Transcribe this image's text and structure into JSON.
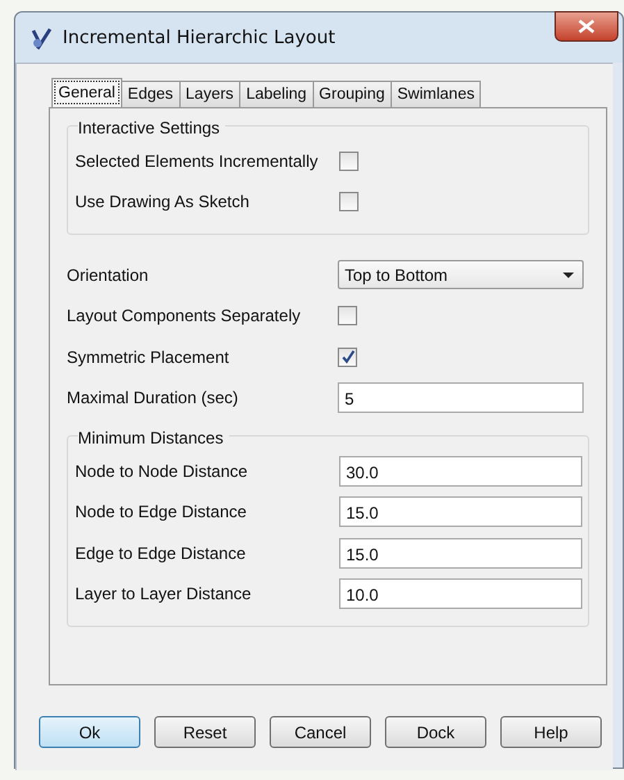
{
  "window": {
    "title": "Incremental Hierarchic Layout"
  },
  "tabs": [
    {
      "label": "General",
      "selected": true
    },
    {
      "label": "Edges",
      "selected": false
    },
    {
      "label": "Layers",
      "selected": false
    },
    {
      "label": "Labeling",
      "selected": false
    },
    {
      "label": "Grouping",
      "selected": false
    },
    {
      "label": "Swimlanes",
      "selected": false
    }
  ],
  "sections": [
    {
      "kind": "group",
      "title": "Interactive Settings",
      "rows": [
        {
          "kind": "checkbox",
          "label": "Selected Elements Incrementally",
          "checked": false
        },
        {
          "kind": "checkbox",
          "label": "Use Drawing As Sketch",
          "checked": false
        }
      ]
    },
    {
      "kind": "plain",
      "rows": [
        {
          "kind": "dropdown",
          "label": "Orientation",
          "value": "Top to Bottom"
        },
        {
          "kind": "checkbox",
          "label": "Layout Components Separately",
          "checked": false
        },
        {
          "kind": "checkbox",
          "label": "Symmetric Placement",
          "checked": true
        },
        {
          "kind": "text",
          "label": "Maximal Duration (sec)",
          "value": "5"
        }
      ]
    },
    {
      "kind": "group",
      "title": "Minimum Distances",
      "rows": [
        {
          "kind": "text",
          "label": "Node to Node Distance",
          "value": "30.0"
        },
        {
          "kind": "text",
          "label": "Node to Edge Distance",
          "value": "15.0"
        },
        {
          "kind": "text",
          "label": "Edge to Edge Distance",
          "value": "15.0"
        },
        {
          "kind": "text",
          "label": "Layer to Layer Distance",
          "value": "10.0"
        }
      ]
    }
  ],
  "buttons": [
    {
      "label": "Ok",
      "selected": true
    },
    {
      "label": "Reset",
      "selected": false
    },
    {
      "label": "Cancel",
      "selected": false
    },
    {
      "label": "Dock",
      "selected": false
    },
    {
      "label": "Help",
      "selected": false
    }
  ]
}
